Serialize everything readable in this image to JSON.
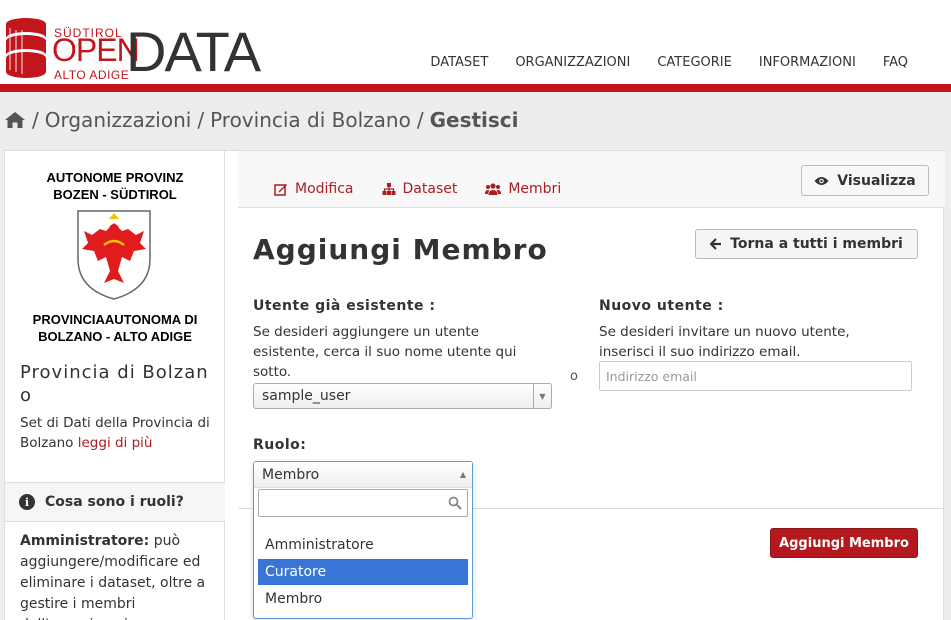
{
  "header": {
    "logo_top": "SÜDTIROL",
    "logo_open": "OPEN",
    "logo_bottom": "ALTO ADIGE",
    "logo_data": "DATA",
    "nav": [
      "DATASET",
      "ORGANIZZAZIONI",
      "CATEGORIE",
      "INFORMAZIONI",
      "FAQ"
    ]
  },
  "breadcrumb": {
    "items": [
      "Organizzazioni",
      "Provincia di Bolzano"
    ],
    "active": "Gestisci",
    "separator": "/"
  },
  "sidebar": {
    "org_head_1": "AUTONOME PROVINZ",
    "org_head_2": "BOZEN - SÜDTIROL",
    "org_foot_1": "PROVINCIAAUTONOMA DI",
    "org_foot_2": "BOLZANO - ALTO ADIGE",
    "title": "Provincia di Bolzano",
    "description": "Set di Dati della Provincia di Bolzano ",
    "read_more": "leggi di più",
    "roles_heading": "Cosa sono i ruoli?",
    "roles_term": "Amministratore:",
    "roles_text": " può aggiungere/modificare ed eliminare i dataset, oltre a gestire i membri dell'organizzazione."
  },
  "tabs": [
    {
      "label": "Modifica",
      "icon": "edit-icon"
    },
    {
      "label": "Dataset",
      "icon": "sitemap-icon"
    },
    {
      "label": "Membri",
      "icon": "users-icon"
    }
  ],
  "actions": {
    "view_label": "Visualizza",
    "back_label": "Torna a tutti i membri",
    "add_label": "Aggiungi Membro"
  },
  "form": {
    "title": "Aggiungi Membro",
    "existing_label": "Utente già esistente :",
    "existing_help": "Se desideri aggiungere un utente esistente, cerca il suo nome utente qui sotto.",
    "existing_value": "sample_user",
    "or_label": "o",
    "new_label": "Nuovo utente :",
    "new_help": "Se desideri invitare un nuovo utente, inserisci il suo indirizzo email.",
    "email_placeholder": "Indirizzo email",
    "role_label": "Ruolo:",
    "role_value": "Membro",
    "role_options": [
      "Amministratore",
      "Curatore",
      "Membro"
    ],
    "role_highlighted": "Curatore"
  },
  "colors": {
    "brand_red": "#c3151c",
    "link_red": "#a91e21",
    "highlight_blue": "#3875d7"
  }
}
